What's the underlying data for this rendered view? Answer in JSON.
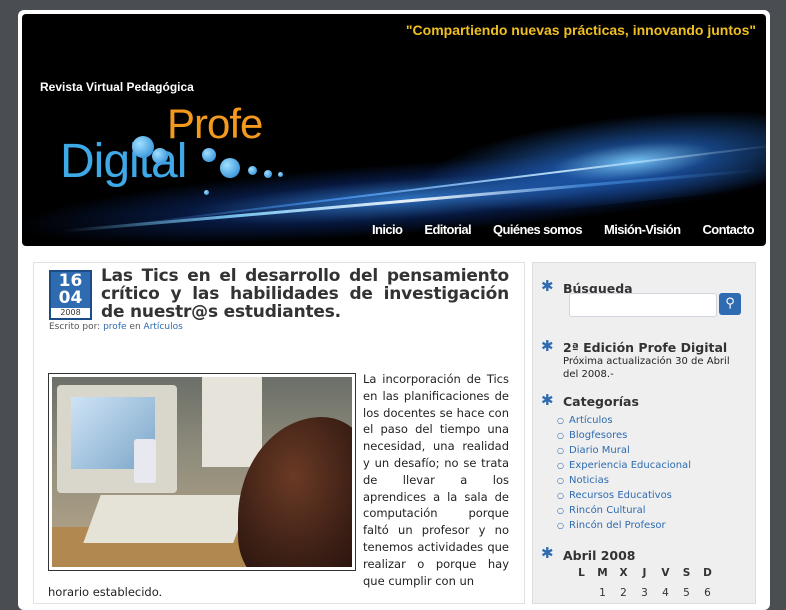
{
  "header": {
    "tagline": "\"Compartiendo nuevas prácticas, innovando juntos\"",
    "subtitle": "Revista Virtual Pedagógica",
    "logo_top": "Profe",
    "logo_bottom": "Digital"
  },
  "nav": {
    "items": [
      "Inicio",
      "Editorial",
      "Quiénes somos",
      "Misión-Visión",
      "Contacto"
    ]
  },
  "post": {
    "date_day": "16",
    "date_month": "04",
    "date_year": "2008",
    "title": "Las Tics en el desarrollo del pensamiento crítico y las habilidades de investigación de nuestr@s estudiantes.",
    "byline_prefix": "Escrito por:",
    "author": "profe",
    "byline_mid": "en",
    "category": "Artículos",
    "body": "La incorporación de Tics en las planificaciones de los docentes se hace con el paso del tiempo una necesidad, una realidad y un desafío; no se trata de llevar a los aprendices a la sala de computación porque faltó un profesor y no tenemos actividades que realizar o porque hay que cumplir con un",
    "body_bottom": "horario establecido."
  },
  "sidebar": {
    "search_title": "Búsqueda",
    "search_button": "⚲",
    "edition_title": "2ª Edición Profe Digital",
    "edition_text": "Próxima actualización 30 de Abril del 2008.-",
    "categories_title": "Categorías",
    "categories": [
      "Artículos",
      "Blogfesores",
      "Diario Mural",
      "Experiencia Educacional",
      "Noticias",
      "Recursos Educativos",
      "Rincón Cultural",
      "Rincón del Profesor"
    ],
    "calendar_title": "Abril 2008",
    "calendar_days": [
      "L",
      "M",
      "X",
      "J",
      "V",
      "S",
      "D"
    ],
    "calendar_first_row": [
      "1",
      "2",
      "3",
      "4",
      "5",
      "6"
    ]
  }
}
